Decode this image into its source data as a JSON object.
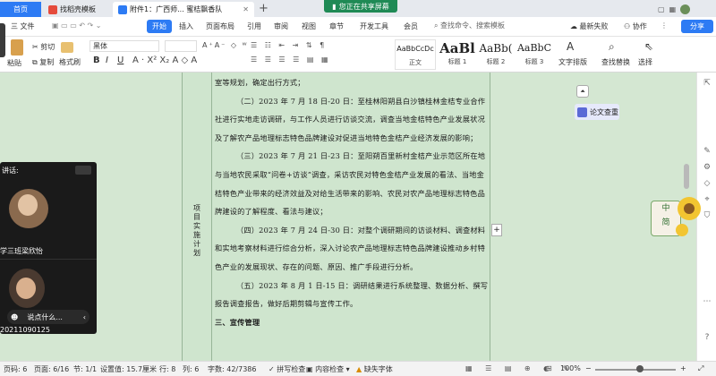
{
  "tabs": {
    "home": "首页",
    "doc1": "找稻壳模板",
    "doc2": "附件1：广西师... 蜜桔飘香队"
  },
  "share_banner": "您正在共享屏幕",
  "menu": {
    "file": "三 文件",
    "start": "开始",
    "insert": "插入",
    "layout": "页面布局",
    "references": "引用",
    "review": "审阅",
    "view": "视图",
    "chapter": "章节",
    "devtools": "开发工具",
    "member": "会员",
    "search_placeholder": "查找命令、搜索模板",
    "sync": "最新失败",
    "collab": "协作",
    "share": "分享"
  },
  "ribbon": {
    "cut": "剪切",
    "copy": "复制",
    "format_painter": "格式刷",
    "paste": "粘贴",
    "font": "黑体",
    "style_normal_preview": "AaBbCcDc",
    "style_normal": "正文",
    "style_h1_preview": "AaBl",
    "style_h1": "标题 1",
    "style_h2_preview": "AaBb(",
    "style_h2": "标题 2",
    "style_h3_preview": "AaBbC",
    "style_h3": "标题 3",
    "text_layout": "文字排版",
    "find_replace": "查找替换",
    "select": "选择"
  },
  "document": {
    "side_label": "项目实施计划",
    "paragraphs": [
      "室等规划，确定出行方式；",
      "（二）2023 年 7 月 18 日-20 日：至桂林阳朔县白沙镇桂林金桔专业合作社进行实地走访调研，与工作人员进行访谈交流，调查当地金桔特色产业发展状况及了解农产品地理标志特色品牌建设对促进当地特色金桔产业经济发展的影响；",
      "（三）2023 年 7 月 21 日-23 日：至阳朔百里新村金桔产业示范区所在地与当地农民采取“问卷+访谈”调查，采访农民对特色金桔产业发展的看法、当地金桔特色产业带来的经济效益及对给生活带来的影响、农民对农产品地理标志特色品牌建设的了解程度、看法与建议；",
      "（四）2023 年 7 月 24 日-30 日：对整个调研期间的访谈材料、调查材料和实地考察材料进行综合分析，深入讨论农产品地理标志特色品牌建设推动乡村特色产业的发展现状、存在的问题、原因、推广手段进行分析。",
      "（五）2023 年 8 月 1 日-15 日：调研结果进行系统整理、数据分析、撰写报告调查报告，做好后期剪辑与宣传工作。",
      "三、宣传管理"
    ]
  },
  "meeting": {
    "speaking_label": "讲话:",
    "participant1": "学三班梁欣怡",
    "chat_placeholder": "说点什么...",
    "participant2_id": "20211090125"
  },
  "right_panel": {
    "paper_check": "论文查重"
  },
  "sticker_text": "中\n简",
  "status": {
    "page": "页码: 6",
    "pages": "页面: 6/16",
    "section": "节: 1/1",
    "setting": "设置值: 15.7厘米",
    "row": "行: 8",
    "col": "列: 6",
    "words": "字数: 42/7386",
    "spellcheck": "拼写检查",
    "content_check": "内容检查",
    "missing_font": "缺失字体",
    "zoom": "100%"
  }
}
